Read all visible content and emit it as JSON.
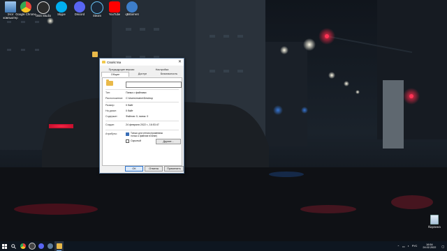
{
  "desktop": {
    "icons": [
      {
        "label": "Этот компьютер",
        "icon": "this-pc-icon",
        "color": "#6fa8dc"
      },
      {
        "label": "Google Chrome",
        "icon": "chrome-icon",
        "color": "#e8453c"
      },
      {
        "label": "OBS Studio",
        "icon": "obs-icon",
        "color": "#2b2b2b"
      },
      {
        "label": "Skype",
        "icon": "skype-icon",
        "color": "#00aff0"
      },
      {
        "label": "Discord",
        "icon": "discord-icon",
        "color": "#5865f2"
      },
      {
        "label": "Steam",
        "icon": "steam-icon",
        "color": "#1b2838"
      },
      {
        "label": "YouTube",
        "icon": "youtube-icon",
        "color": "#ff0000"
      },
      {
        "label": "qBittorrent",
        "icon": "qbittorrent-icon",
        "color": "#3d7dc9"
      }
    ],
    "recycle_bin": "Корзина"
  },
  "dialog": {
    "title": "Свойства",
    "close": "✕",
    "tabs_top": [
      "Предыдущие версии",
      "Настройка"
    ],
    "tabs_bottom": [
      "Общие",
      "Доступ",
      "Безопасность"
    ],
    "name_value": "",
    "rows": [
      {
        "k": "Тип:",
        "v": "Папка с файлами"
      },
      {
        "k": "Расположение:",
        "v": "C:\\Users\\matve\\Desktop"
      },
      {
        "k": "Размер:",
        "v": "0 байт"
      },
      {
        "k": "На диске:",
        "v": "0 байт"
      },
      {
        "k": "Содержит:",
        "v": "Файлов: 0; папок: 0"
      },
      {
        "k": "Создан:",
        "v": "24 февраля 2022 г., 16:53:47"
      }
    ],
    "attributes_label": "Атрибуты:",
    "readonly_label": "Только для чтения (применимо только к файлам в папке)",
    "hidden_label": "Скрытый",
    "other_button": "Другие...",
    "ok": "ОК",
    "cancel": "Отмена",
    "apply": "Применить"
  },
  "taskbar": {
    "apps": [
      {
        "icon": "windows-start-icon",
        "color": "#ffffff"
      },
      {
        "icon": "search-icon",
        "color": "#ffffff"
      },
      {
        "icon": "chrome-icon",
        "color": "#e8453c"
      },
      {
        "icon": "obs-icon",
        "color": "#444444"
      },
      {
        "icon": "discord-icon",
        "color": "#5865f2"
      },
      {
        "icon": "steam-icon",
        "color": "#5d7b99"
      },
      {
        "icon": "file-explorer-icon",
        "color": "#e9b949"
      }
    ],
    "lang": "РУС",
    "time": "16:54",
    "date": "24.02.2022"
  }
}
